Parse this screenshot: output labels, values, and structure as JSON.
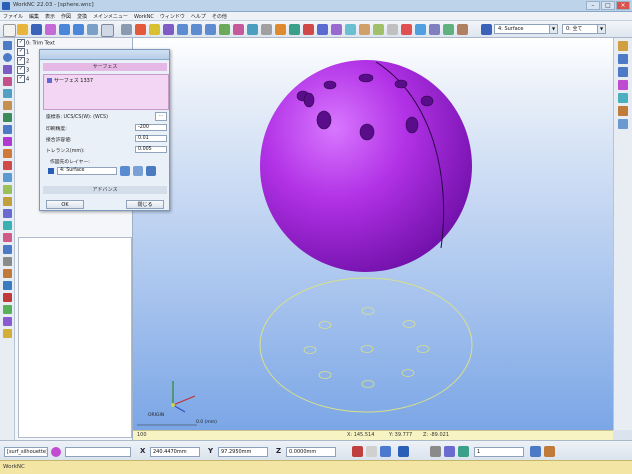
{
  "app": {
    "title": "WorkNC 22.03 - [sphere.wnc]"
  },
  "menu": [
    "ファイル",
    "編集",
    "表示",
    "作図",
    "変換",
    "メインメニュー",
    "WorkNC",
    "ウィンドウ",
    "ヘルプ",
    "その他"
  ],
  "toolbar": {
    "layer_combo": "4: Surface",
    "color_combo": "0: 全て"
  },
  "colors": {
    "sphere": "#b232e6",
    "sphere_shadow": "#7a14b0",
    "wireframe": "#d8e08a",
    "dialog_section": "#e6b8e6",
    "accent": "#2a5fb8"
  },
  "layers": {
    "rows": [
      {
        "label": "0: Trim Text",
        "checked": true
      },
      {
        "label": "1",
        "checked": true
      },
      {
        "label": "2",
        "checked": true
      },
      {
        "label": "3",
        "checked": true
      },
      {
        "label": "4",
        "checked": true
      }
    ]
  },
  "dialog": {
    "title": "",
    "section1": "サーフェス",
    "list_item": "サーフェス 1337",
    "row_system": "座標系: UCS/CS(W): (WCS)",
    "row1_label": "印刷精度:",
    "row1_value": "-200",
    "row2_label": "接合許容値:",
    "row2_value": "0.01",
    "row3_label": "トレランス(mm):",
    "row3_value": "0.005",
    "row4_label": "作図先のレイヤー:",
    "layer_value": "4: Surface",
    "section2": "アドバンス",
    "ok": "OK",
    "close": "閉じる"
  },
  "viewport": {
    "axis_label": "ORIGIN",
    "scale_label": "0.0 (mm)"
  },
  "coords_strip": {
    "x": "X: 145.514",
    "y": "Y: 39.777",
    "z": "Z: -89.021",
    "zoom": "100"
  },
  "bottom": {
    "function_combo": "[surf_silhouette]",
    "x_label": "X",
    "x_value": "240.4470mm",
    "y_label": "Y",
    "y_value": "97.2950mm",
    "z_label": "Z",
    "z_value": "0.0000mm",
    "count_value": "1"
  },
  "status": {
    "text": "WorkNC"
  }
}
